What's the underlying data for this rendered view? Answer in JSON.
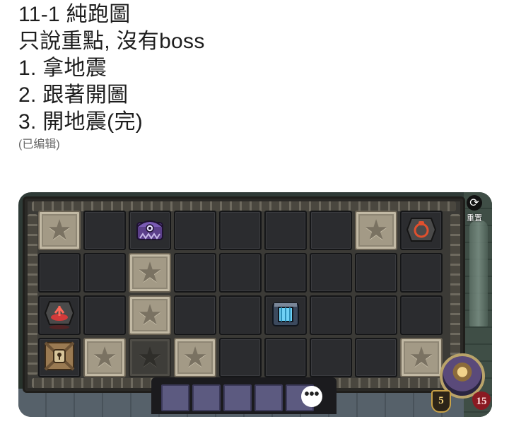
{
  "post": {
    "lines": [
      "11-1 純跑圖",
      "只說重點, 沒有boss",
      "1.  拿地震",
      "2.  跟著開圖",
      "3.  開地震(完)"
    ],
    "edited_label": "(已编辑)"
  },
  "game": {
    "refresh_label": "重置",
    "refresh_icon": "refresh-icon",
    "shield_value": "5",
    "heart_value": "15",
    "more_glyph": "•••",
    "inventory_slots": 5,
    "tile_types": [
      [
        "star",
        "empty",
        "chest-purple",
        "empty",
        "empty",
        "empty",
        "empty",
        "star",
        "potion-item"
      ],
      [
        "empty",
        "empty",
        "star",
        "empty",
        "empty",
        "empty",
        "empty",
        "empty",
        "empty"
      ],
      [
        "earthquake-item",
        "empty",
        "star",
        "empty",
        "empty",
        "chest-blue",
        "empty",
        "empty",
        "empty"
      ],
      [
        "locked-crate",
        "star",
        "star-dark",
        "star",
        "empty",
        "empty",
        "empty",
        "empty",
        "star"
      ]
    ],
    "colors": {
      "star_tile": "#a39a86",
      "empty_tile": "#2b2c2f",
      "slot": "#5c5a80"
    }
  }
}
